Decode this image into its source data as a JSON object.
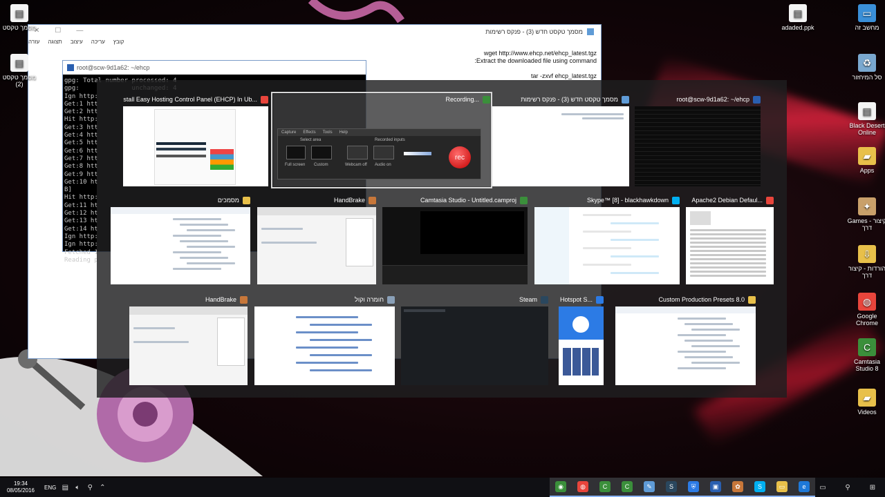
{
  "desktop_icons": [
    {
      "label": "מחשב זה",
      "icon": "computer-icon"
    },
    {
      "label": "סל המיחזור",
      "icon": "recycle-bin-icon"
    },
    {
      "label": "Black Desert Online",
      "icon": "document-icon"
    },
    {
      "label": "Apps",
      "icon": "folder-icon"
    },
    {
      "label": "Games - קיצור דרך",
      "icon": "games-icon"
    },
    {
      "label": "הורדות - קיצור דרך",
      "icon": "downloads-icon"
    },
    {
      "label": "Google Chrome",
      "icon": "chrome-icon"
    },
    {
      "label": "Camtasia Studio 8",
      "icon": "camtasia-icon"
    },
    {
      "label": "Videos",
      "icon": "folder-icon"
    },
    {
      "label": "adaded.ppk",
      "icon": "file-icon"
    },
    {
      "label": "מסמך טקסט",
      "icon": "text-file-icon"
    },
    {
      "label": "מסמך טקסט (2)",
      "icon": "text-file-icon"
    }
  ],
  "notepad_bg": {
    "title": "מסמך טקסט חדש (3) - פנקס רשימות",
    "menu": [
      "קובץ",
      "עריכה",
      "עיצוב",
      "תצוגה",
      "עזרה"
    ],
    "lines": [
      "wget http://www.ehcp.net/ehcp_latest.tgz",
      ":Extract the downloaded file using command",
      "",
      "tar -zxvf ehcp_latest.tgz"
    ]
  },
  "terminal_bg": {
    "title": "root@scw-9d1a62: ~/ehcp",
    "lines": [
      "gpg: Total number processed: 4",
      "gpg:              unchanged: 4",
      "Ign http:",
      "Get:1 htt",
      "Get:2 htt",
      "Hit http:",
      "Get:3 htt",
      "Get:4 htt",
      "Get:5 htt",
      "Get:6 htt",
      "Get:7 htt",
      "Get:8 htt",
      "Get:9 htt",
      "Get:10 ht",
      "B]",
      "Hit http:",
      "Get:11 ht",
      "Get:12 ht",
      "Get:13 ht",
      "Get:14 ht",
      "Ign http:",
      "Ign http:",
      "Fetched 1",
      "Reading p"
    ]
  },
  "switcher": {
    "rows": [
      [
        {
          "title": "Install Easy Hosting Control Panel (EHCP) In Ub...",
          "icon": "chrome-icon",
          "color": "#e8453c",
          "body": "web"
        },
        {
          "title": "Recording...",
          "icon": "camtasia-recorder-icon",
          "color": "#3b8f3b",
          "body": "recorder",
          "selected": true
        },
        {
          "title": "מסמך טקסט חדש (3) - פנקס רשימות",
          "icon": "notepad-icon",
          "color": "#5f9bd6",
          "body": "notepad"
        },
        {
          "title": "root@scw-9d1a62: ~/ehcp",
          "icon": "terminal-icon",
          "color": "#2a5fb0",
          "body": "terminal"
        }
      ],
      [
        {
          "title": "מסמכים",
          "icon": "folder-icon",
          "color": "#e8c04a",
          "body": "explorer"
        },
        {
          "title": "HandBrake",
          "icon": "handbrake-icon",
          "color": "#c7773a",
          "body": "handbrake"
        },
        {
          "title": "Camtasia Studio - Untitled.camproj",
          "icon": "camtasia-icon",
          "color": "#3b8f3b",
          "body": "camtasia"
        },
        {
          "title": "Skype™ [8] - blackhawkdown",
          "icon": "skype-icon",
          "color": "#00aff0",
          "body": "skype"
        },
        {
          "title": "Apache2 Debian Defaul...",
          "icon": "chrome-icon",
          "color": "#e8453c",
          "body": "apache"
        }
      ],
      [
        {
          "title": "HandBrake",
          "icon": "handbrake-icon",
          "color": "#c7773a",
          "body": "handbrake"
        },
        {
          "title": "חומרה וקול",
          "icon": "control-panel-icon",
          "color": "#8aa0b8",
          "body": "controlpanel"
        },
        {
          "title": "Steam",
          "icon": "steam-icon",
          "color": "#2a475e",
          "body": "steam"
        },
        {
          "title": "Hotspot S...",
          "icon": "hotspot-shield-icon",
          "color": "#2c7be5",
          "body": "hotspot"
        },
        {
          "title": "Custom Production Presets 8.0",
          "icon": "folder-icon",
          "color": "#e8c04a",
          "body": "explorer2"
        }
      ]
    ],
    "recorder": {
      "menu": [
        "Capture",
        "Effects",
        "Tools",
        "Help"
      ],
      "select_area": "Select area",
      "recorded_inputs": "Recorded inputs",
      "full_screen": "Full screen",
      "custom": "Custom",
      "webcam": "Webcam off",
      "audio": "Audio on",
      "rec": "rec"
    }
  },
  "taskbar": {
    "time": "19:34",
    "date": "08/05/2016",
    "lang": "ENG",
    "apps": [
      {
        "icon": "camtasia-recorder-icon",
        "color": "#3b8f3b",
        "glyph": "◉"
      },
      {
        "icon": "chrome-icon",
        "color": "#e8453c",
        "glyph": "◍"
      },
      {
        "icon": "camtasia-icon",
        "color": "#3b8f3b",
        "glyph": "C"
      },
      {
        "icon": "camtasia-studio-icon",
        "color": "#3b8f3b",
        "glyph": "C"
      },
      {
        "icon": "notepad-icon",
        "color": "#5f9bd6",
        "glyph": "✎"
      },
      {
        "icon": "steam-icon",
        "color": "#2a475e",
        "glyph": "S"
      },
      {
        "icon": "hotspot-shield-icon",
        "color": "#2c7be5",
        "glyph": "⛨"
      },
      {
        "icon": "putty-icon",
        "color": "#2a5fb0",
        "glyph": "▣"
      },
      {
        "icon": "handbrake-icon",
        "color": "#c7773a",
        "glyph": "✿"
      },
      {
        "icon": "skype-icon",
        "color": "#00aff0",
        "glyph": "S"
      },
      {
        "icon": "file-explorer-icon",
        "color": "#e8c04a",
        "glyph": "▭"
      },
      {
        "icon": "edge-icon",
        "color": "#1e78d7",
        "glyph": "e"
      }
    ]
  }
}
